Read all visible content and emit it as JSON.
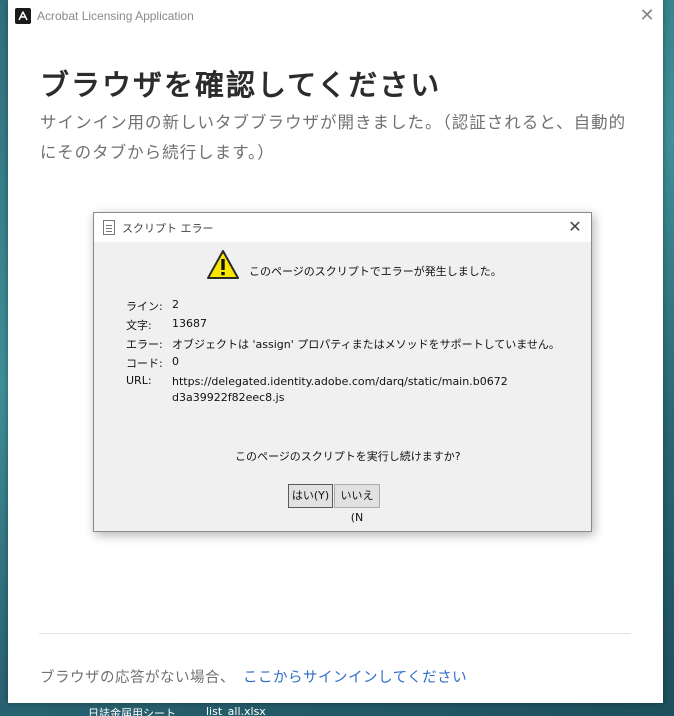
{
  "window": {
    "title": "Acrobat Licensing Application",
    "close_glyph": "✕"
  },
  "main": {
    "heading": "ブラウザを確認してください",
    "subtext": "サインイン用の新しいタブブラウザが開きました。（認証されると、自動的にそのタブから続行します。）",
    "footer_text": "ブラウザの応答がない場合、",
    "footer_link": "ここからサインインしてください"
  },
  "dialog": {
    "title": "スクリプト エラー",
    "close_glyph": "✕",
    "headline": "このページのスクリプトでエラーが発生しました。",
    "rows": [
      {
        "label": "ライン:",
        "value": "2"
      },
      {
        "label": "文字:",
        "value": "13687"
      },
      {
        "label": "エラー:",
        "value": "オブジェクトは 'assign' プロパティまたはメソッドをサポートしていません。"
      },
      {
        "label": "コード:",
        "value": "0"
      },
      {
        "label": "URL:",
        "value": "https://delegated.identity.adobe.com/darq/static/main.b0672d3a39922f82eec8.js"
      }
    ],
    "question": "このページのスクリプトを実行し続けますか?",
    "yes_label": "はい(Y)",
    "no_label": "いいえ(N"
  },
  "desktop": {
    "bottom_item_1": "日誌金届用シート",
    "bottom_item_2": "list_all.xlsx"
  },
  "icons": {
    "app_logo": "acrobat-logo-icon",
    "dialog_icon": "document-icon",
    "warning": "warning-icon"
  },
  "colors": {
    "link": "#2e6ecb",
    "heading": "#2c2c2c",
    "subtext": "#707070",
    "warning_fill": "#f7e600"
  }
}
